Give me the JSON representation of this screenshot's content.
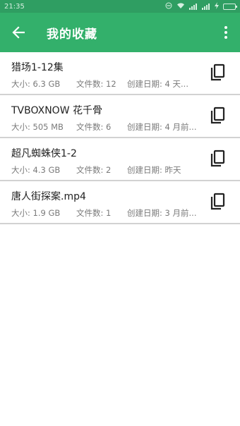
{
  "status_bar": {
    "time": "21:35"
  },
  "app_bar": {
    "title": "我的收藏"
  },
  "icons": {
    "back": "arrow-back-icon",
    "menu": "more-vert-icon",
    "copy": "copy-icon"
  },
  "colors": {
    "status_bar": "#2f9e62",
    "app_bar": "#33b06b",
    "divider": "#d2d2d2"
  },
  "items": [
    {
      "name": "猎场1-12集",
      "size": "大小: 6.3 GB",
      "count": "文件数: 12",
      "date": "创建日期: 4 天..."
    },
    {
      "name": "TVBOXNOW 花千骨",
      "size": "大小: 505 MB",
      "count": "文件数: 6",
      "date": "创建日期: 4 月前..."
    },
    {
      "name": "超凡蜘蛛侠1-2",
      "size": "大小: 4.3 GB",
      "count": "文件数: 2",
      "date": "创建日期: 昨天"
    },
    {
      "name": "唐人街探案.mp4",
      "size": "大小: 1.9 GB",
      "count": "文件数: 1",
      "date": "创建日期: 3 月前..."
    }
  ]
}
